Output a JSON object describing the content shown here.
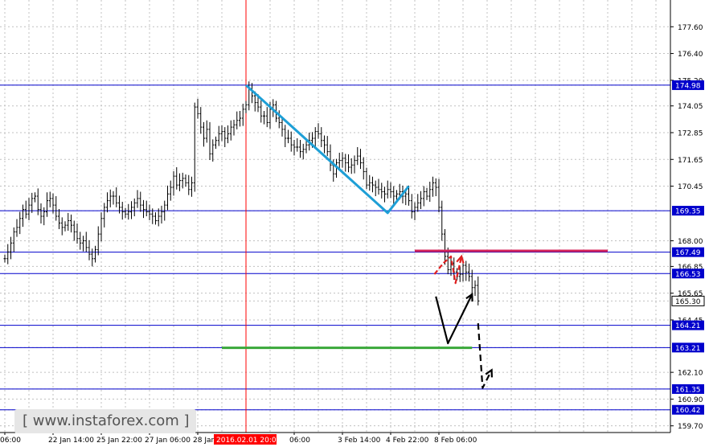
{
  "chart_data": {
    "type": "line",
    "symbol_style": "ohlc-bars",
    "colors": {
      "background": "#ffffff",
      "grid": "#c0c0c0",
      "level_line": "#0000cc",
      "level_label_bg": "#0000cc",
      "price_label_bg": "#ffffff",
      "bars": "#000000",
      "marker_line": "#ff0000",
      "trend": "#1e9fd6",
      "resistance": "#d4235a",
      "support": "#3aa83a",
      "forecast_up": "#000000",
      "forecast_alt": "#e02020"
    },
    "y_axis": {
      "ylim": [
        159.4,
        178.8
      ],
      "ticks": [
        "159.70",
        "160.42",
        "160.90",
        "161.35",
        "162.10",
        "163.21",
        "164.45",
        "165.30",
        "165.65",
        "166.85",
        "168.00",
        "169.35",
        "170.45",
        "171.65",
        "172.85",
        "174.05",
        "174.98",
        "175.20",
        "176.40",
        "177.60"
      ]
    },
    "x_axis": {
      "ticks": [
        {
          "label": "06:00",
          "i": 0
        },
        {
          "label": "22 Jan 14:00",
          "i": 16
        },
        {
          "label": "25 Jan 22:00",
          "i": 32
        },
        {
          "label": "27 Jan 06:00",
          "i": 48
        },
        {
          "label": "28 Jan 14:00",
          "i": 64
        },
        {
          "label": "2016.02.01 20:00",
          "i": 80,
          "highlight": true
        },
        {
          "label": "06:00",
          "i": 96
        },
        {
          "label": "3 Feb 14:00",
          "i": 112
        },
        {
          "label": "4 Feb 22:00",
          "i": 128
        },
        {
          "label": "8 Feb 06:00",
          "i": 144
        }
      ]
    },
    "series": [
      {
        "close": [
          167.2,
          167.5,
          167.9,
          168.4,
          168.6,
          169.0,
          169.4,
          169.2,
          169.6,
          169.9,
          170.0,
          169.4,
          169.1,
          169.3,
          169.8,
          169.9,
          169.6,
          169.1,
          168.8,
          168.6,
          168.7,
          168.9,
          168.7,
          168.4,
          168.1,
          167.9,
          168.0,
          167.7,
          167.4,
          167.2,
          167.6,
          168.3,
          169.0,
          169.5,
          169.8,
          170.0,
          170.0,
          169.7,
          169.5,
          169.3,
          169.2,
          169.3,
          169.5,
          169.7,
          169.9,
          169.6,
          169.4,
          169.3,
          169.2,
          169.1,
          168.9,
          169.1,
          169.3,
          169.6,
          170.1,
          170.4,
          170.9,
          170.5,
          170.7,
          170.8,
          170.6,
          170.3,
          170.6,
          174.0,
          173.7,
          173.1,
          172.6,
          173.0,
          171.9,
          172.3,
          172.5,
          172.8,
          172.9,
          172.6,
          172.8,
          173.1,
          173.2,
          173.4,
          173.5,
          173.9,
          174.1,
          174.8,
          174.5,
          174.2,
          174.0,
          173.6,
          173.6,
          173.3,
          173.9,
          174.1,
          173.5,
          173.3,
          173.0,
          172.6,
          172.6,
          172.3,
          172.2,
          172.2,
          172.0,
          172.1,
          172.3,
          172.5,
          172.6,
          172.9,
          172.8,
          172.5,
          172.3,
          172.0,
          171.4,
          171.0,
          171.5,
          171.6,
          171.7,
          171.5,
          171.3,
          171.4,
          171.6,
          171.8,
          171.5,
          171.1,
          170.5,
          170.6,
          170.5,
          170.4,
          170.3,
          170.2,
          170.1,
          170.3,
          170.2,
          170.0,
          170.1,
          170.2,
          170.0,
          170.1,
          169.8,
          169.3,
          169.5,
          169.7,
          169.9,
          170.2,
          170.0,
          170.3,
          170.6,
          170.4,
          169.5,
          168.3,
          167.3,
          166.7,
          167.0,
          166.6,
          166.4,
          166.5,
          166.9,
          166.6,
          166.4,
          165.9,
          166.0,
          165.3
        ]
      }
    ],
    "levels": [
      {
        "value": 174.98,
        "label": "174.98"
      },
      {
        "value": 169.35,
        "label": "169.35"
      },
      {
        "value": 167.49,
        "label": "167.49"
      },
      {
        "value": 166.53,
        "label": "166.53"
      },
      {
        "value": 164.21,
        "label": "164.21"
      },
      {
        "value": 163.21,
        "label": "163.21"
      },
      {
        "value": 161.35,
        "label": "161.35"
      },
      {
        "value": 160.42,
        "label": "160.42"
      }
    ],
    "current_price": {
      "value": 165.3,
      "label": "165.30"
    },
    "marker_vertical": {
      "i": 80
    },
    "annotations": {
      "trend": [
        {
          "i": 80,
          "p": 174.98
        },
        {
          "i": 127,
          "p": 169.25
        },
        {
          "i": 134,
          "p": 170.45
        }
      ],
      "resistance": {
        "from_i": 136,
        "to_i": 200,
        "p": 167.55
      },
      "support": {
        "from_i": 72,
        "to_i": 155,
        "p": 163.2
      },
      "alt_path": [
        [
          142.5,
          166.5
        ],
        [
          145.5,
          167.0
        ],
        [
          148,
          167.3
        ],
        [
          149.5,
          166.1
        ],
        [
          151.5,
          167.3
        ]
      ],
      "main_path": [
        [
          143,
          165.5
        ],
        [
          147,
          163.4
        ],
        [
          155,
          165.6
        ]
      ],
      "down_path": [
        [
          157,
          164.3
        ],
        [
          158.5,
          161.4
        ],
        [
          161.5,
          162.2
        ]
      ]
    },
    "bar_range": 0.5
  },
  "watermark": "[ www.instaforex.com ]"
}
